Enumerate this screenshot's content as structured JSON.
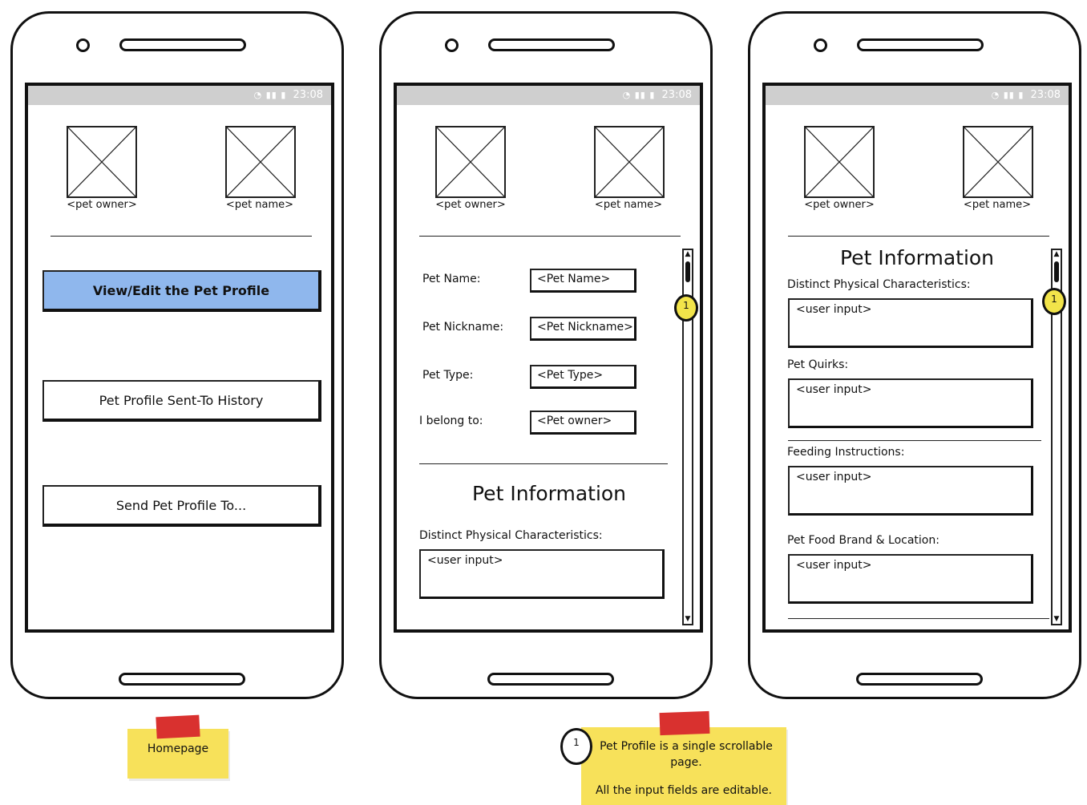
{
  "status_bar": {
    "icons": "wifi signal battery",
    "time": "23:08"
  },
  "header": {
    "owner_caption": "<pet owner>",
    "pet_caption": "<pet name>"
  },
  "homepage": {
    "buttons": [
      "View/Edit the Pet Profile",
      "Pet Profile Sent-To History",
      "Send Pet Profile To..."
    ]
  },
  "profile": {
    "fields": [
      {
        "label": "Pet Name:",
        "value": "<Pet Name>"
      },
      {
        "label": "Pet Nickname:",
        "value": "<Pet Nickname>"
      },
      {
        "label": "Pet Type:",
        "value": "<Pet Type>"
      },
      {
        "label": "I belong to:",
        "value": "<Pet owner>"
      }
    ],
    "section_title": "Pet Information",
    "first_section_label": "Distinct Physical Characteristics:",
    "user_input_placeholder": "<user input>"
  },
  "pet_info": {
    "title": "Pet Information",
    "sections": [
      {
        "label": "Distinct Physical Characteristics:",
        "value": "<user input>"
      },
      {
        "label": "Pet Quirks:",
        "value": "<user input>"
      },
      {
        "label": "Feeding Instructions:",
        "value": "<user input>"
      },
      {
        "label": "Pet Food Brand & Location:",
        "value": "<user input>"
      }
    ]
  },
  "markers": {
    "scroll_marker": "1"
  },
  "notes": {
    "homepage": "Homepage",
    "marker": "1",
    "profile_line1": "Pet Profile is a single scrollable page.",
    "profile_line2": "All the input fields are editable."
  },
  "colors": {
    "primary_button": "#8fb7ed",
    "sticky_note": "#f7e15a",
    "tape": "#d9312f",
    "status_bar": "#cfcfcf",
    "marker": "#f2e44a"
  },
  "icons": [
    "wifi-icon",
    "signal-icon",
    "battery-icon",
    "image-placeholder-icon",
    "scroll-up-icon",
    "scroll-down-icon"
  ]
}
